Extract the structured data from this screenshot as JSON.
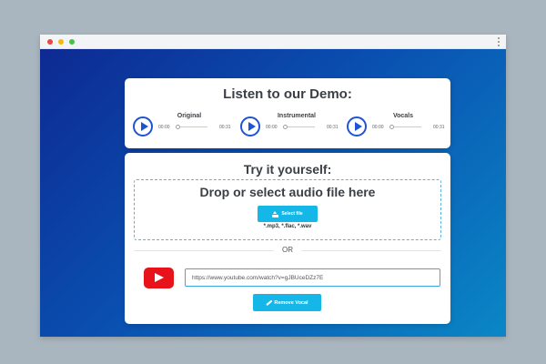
{
  "demo": {
    "title": "Listen to our Demo:",
    "players": [
      {
        "label": "Original",
        "time_start": "00:00",
        "time_end": "00:31",
        "icon": "play-icon"
      },
      {
        "label": "Instrumental",
        "time_start": "00:00",
        "time_end": "00:31",
        "icon": "play-icon"
      },
      {
        "label": "Vocals",
        "time_start": "00:00",
        "time_end": "00:31",
        "icon": "play-icon"
      }
    ]
  },
  "upload": {
    "title": "Try it yourself:",
    "drop_title": "Drop or select audio file here",
    "select_button": "Select file",
    "select_icon": "upload-icon",
    "formats": "*.mp3, *.flac, *.wav",
    "or_label": "OR",
    "youtube_icon": "youtube-icon",
    "url_value": "https://www.youtube.com/watch?v=gJBUceDZz7E",
    "remove_button": "Remove Vocal",
    "remove_icon": "magic-wand-icon"
  },
  "colors": {
    "accent": "#14b7e8",
    "play": "#1e53d6",
    "youtube": "#e8121a",
    "gradient_start": "#0d2a92",
    "gradient_end": "#0a87c6"
  }
}
